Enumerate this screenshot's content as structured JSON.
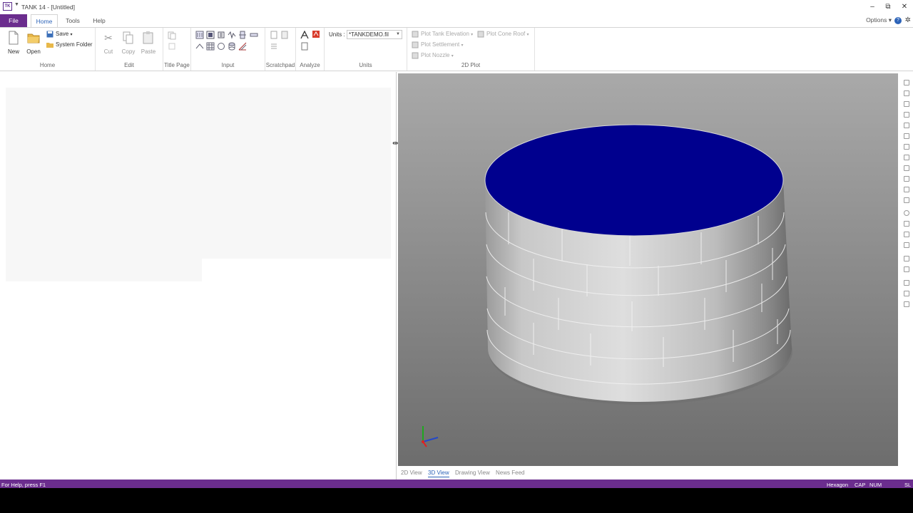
{
  "window": {
    "title": "TANK 14 - [Untitled]",
    "app_icon_text": "TK",
    "controls": [
      "–",
      "⧉",
      "✕"
    ]
  },
  "ribbon_tabs": {
    "file": "File",
    "tabs": [
      "Home",
      "Tools",
      "Help"
    ],
    "active": "Home",
    "options": "Options"
  },
  "ribbon": {
    "home": {
      "label": "Home",
      "new": "New",
      "open": "Open",
      "save": "Save",
      "system_folder": "System Folder"
    },
    "edit": {
      "label": "Edit",
      "cut": "Cut",
      "copy": "Copy",
      "paste": "Paste"
    },
    "title_page": {
      "label": "Title Page"
    },
    "input": {
      "label": "Input"
    },
    "scratchpad": {
      "label": "Scratchpad"
    },
    "analyze": {
      "label": "Analyze"
    },
    "units": {
      "label": "Units",
      "field_label": "Units :",
      "value": "*TANKDEMO.fil"
    },
    "plot2d": {
      "label": "2D Plot",
      "plot_tank_elevation": "Plot Tank Elevation",
      "plot_cone_roof": "Plot Cone Roof",
      "plot_settlement": "Plot Settlement",
      "plot_nozzle": "Plot Nozzle"
    }
  },
  "view_tabs": {
    "tabs": [
      "2D View",
      "3D View",
      "Drawing View",
      "News Feed"
    ],
    "active": "3D View"
  },
  "status": {
    "left": "For Help, press F1",
    "right": [
      "Hexagon",
      "CAP",
      "NUM",
      "SL"
    ]
  },
  "colors": {
    "accent": "#6b2d8e",
    "roof": "#00008e",
    "link": "#2c63b8"
  }
}
